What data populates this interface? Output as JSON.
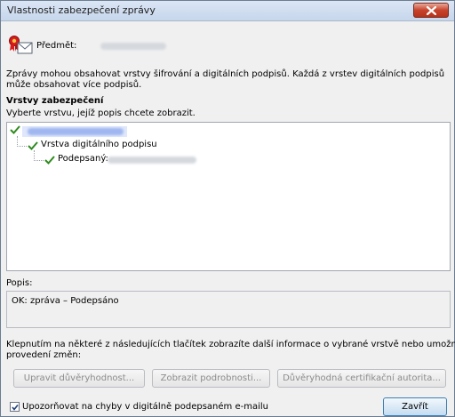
{
  "window": {
    "title": "Vlastnosti zabezpečení zprávy"
  },
  "subject": {
    "label": "Předmět:"
  },
  "intro_text": {
    "line1": "Zprávy mohou obsahovat vrstvy šifrování a digitálních podpisů. Každá z vrstev digitálních podpisů",
    "line2": "může obsahovat více podpisů."
  },
  "layers": {
    "heading": "Vrstvy zabezpečení",
    "instruction": "Vyberte vrstvu, jejíž popis chcete zobrazit.",
    "tree": {
      "item_signature_layer": "Vrstva digitálního podpisu",
      "item_signer_label": "Podepsaný:"
    }
  },
  "description": {
    "label": "Popis:",
    "value": "OK: zpráva – Podepsáno"
  },
  "help_text": {
    "line1": "Klepnutím na některé z následujících tlačítek zobrazíte další informace o vybrané vrstvě nebo umožníte",
    "line2": "provedení změn:"
  },
  "buttons": {
    "edit_trust": "Upravit důvěryhodnost...",
    "view_details": "Zobrazit podrobnosti...",
    "trusted_ca": "Důvěryhodná certifikační autorita...",
    "close": "Zavřít"
  },
  "warn_option": {
    "label": "Upozorňovat na chyby v digitálně podepsaném e-mailu",
    "checked": true
  },
  "icons": {
    "close": "close-icon",
    "secure_mail": "signed-mail-icon",
    "check": "green-check-icon"
  },
  "colors": {
    "check_green": "#2e8b1e",
    "close_red": "#c7432b",
    "selection": "#dfe7fb"
  }
}
